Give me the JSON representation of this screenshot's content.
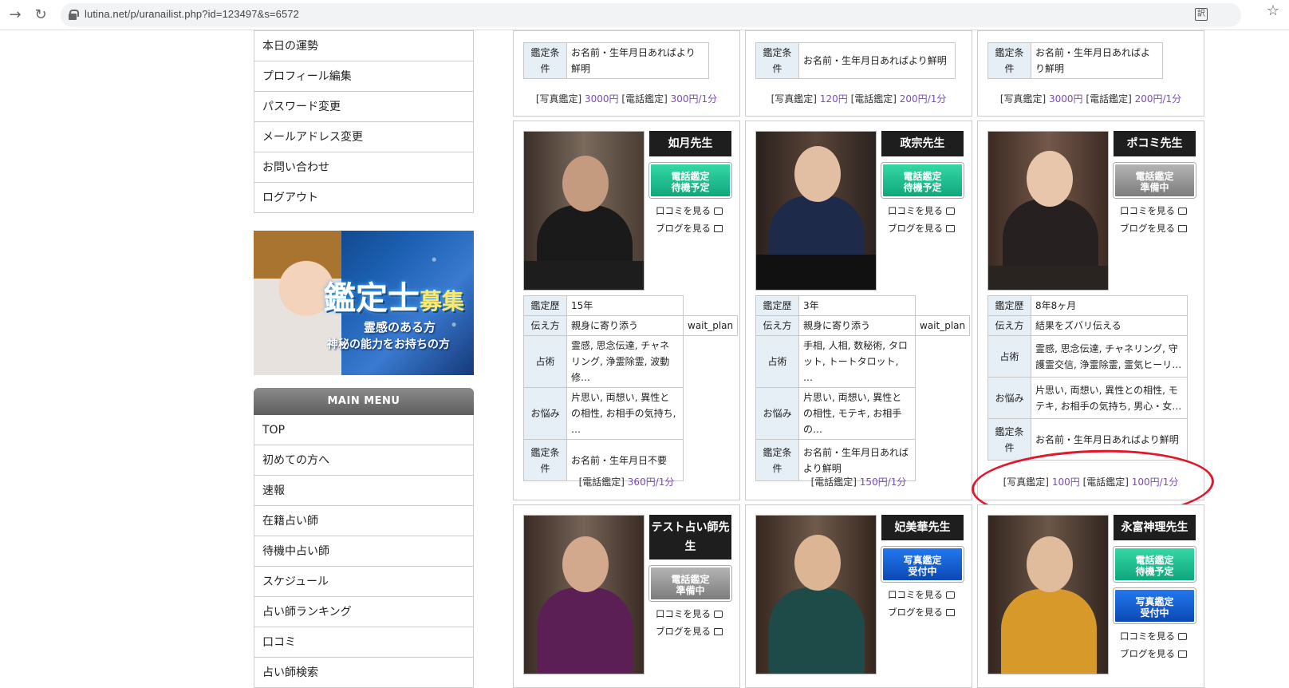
{
  "browser": {
    "url": "lutina.net/p/uranailist.php?id=123497&s=6572"
  },
  "sidebar": {
    "account_menu": [
      "本日の運勢",
      "プロフィール編集",
      "パスワード変更",
      "メールアドレス変更",
      "お問い合わせ",
      "ログアウト"
    ],
    "banner": {
      "title": "鑑定士",
      "title_suffix": "募集",
      "line1": "霊感のある方",
      "line2": "神秘の能力をお持ちの方"
    },
    "main_menu_header": "MAIN MENU",
    "main_menu": [
      "TOP",
      "初めての方へ",
      "速報",
      "在籍占い師",
      "待機中占い師",
      "スケジュール",
      "占い師ランキング",
      "口コミ",
      "占い師検索"
    ]
  },
  "top_row": [
    {
      "cond_label": "鑑定条件",
      "cond": "お名前・生年月日あればより鮮明",
      "price_label1": "[写真鑑定]",
      "price1": "3000円",
      "price_label2": "[電話鑑定]",
      "price2": "300円/1分"
    },
    {
      "cond_label": "鑑定条件",
      "cond": "お名前・生年月日あればより鮮明",
      "price_label1": "[写真鑑定]",
      "price1": "120円",
      "price_label2": "[電話鑑定]",
      "price2": "200円/1分"
    },
    {
      "cond_label": "鑑定条件",
      "cond": "お名前・生年月日あればより鮮明",
      "price_label1": "[写真鑑定]",
      "price1": "3000円",
      "price_label2": "[電話鑑定]",
      "price2": "200円/1分"
    }
  ],
  "labels": {
    "review": "口コミを見る",
    "blog": "ブログを見る",
    "years": "鑑定歴",
    "style": "伝え方",
    "methods": "占術",
    "worries": "お悩み",
    "conditions": "鑑定条件"
  },
  "middle_row": [
    {
      "name": "如月先生",
      "status": "電話鑑定\n待機予定",
      "years": "15年",
      "style": "親身に寄り添う",
      "style_extra": "wait_plan",
      "methods": "霊感, 思念伝達, チャネリング, 浄霊除霊, 波動修…",
      "worries": "片思い, 両想い, 異性との相性, お相手の気持ち, …",
      "cond": "お名前・生年月日不要",
      "price_label1": "[電話鑑定]",
      "price1": "360円/1分"
    },
    {
      "name": "政宗先生",
      "status": "電話鑑定\n待機予定",
      "years": "3年",
      "style": "親身に寄り添う",
      "style_extra": "wait_plan",
      "methods": "手相, 人相, 数秘術, タロット, トートタロット, …",
      "worries": "片思い, 両想い, 異性との相性, モテキ, お相手の…",
      "cond": "お名前・生年月日あればより鮮明",
      "price_label1": "[電話鑑定]",
      "price1": "150円/1分"
    },
    {
      "name": "ポコミ先生",
      "status": "電話鑑定\n準備中",
      "years": "8年8ヶ月",
      "style": "結果をズバリ伝える",
      "style_extra": "",
      "methods": "霊感, 思念伝達, チャネリング, 守護霊交信, 浄霊除霊, 霊気ヒーリ…",
      "worries": "片思い, 両想い, 異性との相性, モテキ, お相手の気持ち, 男心・女…",
      "cond": "お名前・生年月日あればより鮮明",
      "price_label1": "[写真鑑定]",
      "price1": "100円",
      "price_label2": "[電話鑑定]",
      "price2": "100円/1分"
    }
  ],
  "bottom_row": [
    {
      "name": "テスト占い師先生",
      "status1": "電話鑑定\n準備中"
    },
    {
      "name": "妃美華先生",
      "status1": "写真鑑定\n受付中"
    },
    {
      "name": "永富神理先生",
      "status1": "電話鑑定\n待機予定",
      "status2": "写真鑑定\n受付中"
    }
  ],
  "colors": {
    "accent_price": "#7a4bb8",
    "status_green": "#17b488",
    "status_gray": "#8e8e8e",
    "status_blue": "#1460d2",
    "annotation_red": "#e2172a"
  }
}
